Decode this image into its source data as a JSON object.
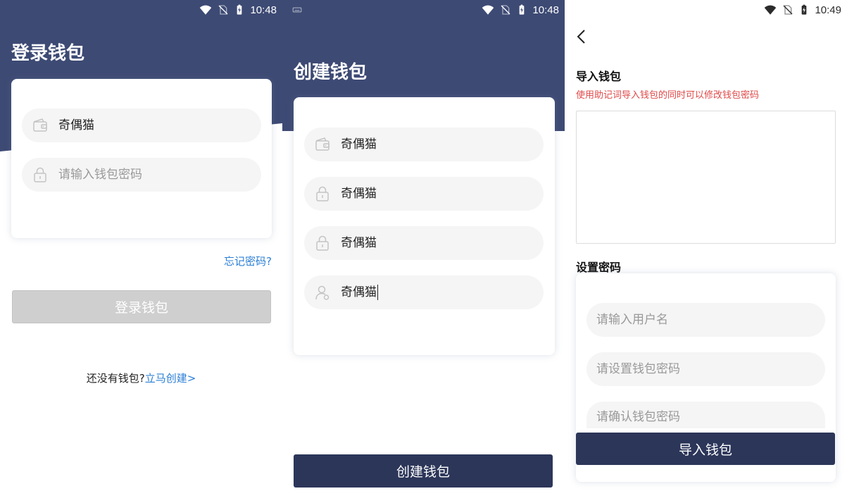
{
  "screens": {
    "login": {
      "status": {
        "time": "10:48"
      },
      "title": "登录钱包",
      "wallet_field": {
        "value": "奇偶猫",
        "icon": "wallet-icon"
      },
      "password_field": {
        "placeholder": "请输入钱包密码",
        "icon": "lock-icon"
      },
      "forgot_link": "忘记密码?",
      "login_button": "登录钱包",
      "no_wallet_text": "还没有钱包?",
      "create_link": "立马创建>"
    },
    "create": {
      "status": {
        "time": "10:48"
      },
      "title": "创建钱包",
      "fields": [
        {
          "value": "奇偶猫",
          "icon": "wallet-icon"
        },
        {
          "value": "奇偶猫",
          "icon": "lock-icon"
        },
        {
          "value": "奇偶猫",
          "icon": "lock-icon"
        },
        {
          "value": "奇偶猫",
          "icon": "user-icon"
        }
      ],
      "create_button": "创建钱包"
    },
    "import": {
      "status": {
        "time": "10:49"
      },
      "section_title": "导入钱包",
      "hint": "使用助记词导入钱包的同时可以修改钱包密码",
      "mnemonic_value": "",
      "password_section_title": "设置密码",
      "username_placeholder": "请输入用户名",
      "password_placeholder": "请设置钱包密码",
      "confirm_placeholder": "请确认钱包密码",
      "import_button": "导入钱包"
    }
  },
  "colors": {
    "header": "#3d4a74",
    "primary_button": "#2c3659",
    "link": "#2b7fd6",
    "hint": "#e04848",
    "disabled_button": "#cfcfcf"
  }
}
